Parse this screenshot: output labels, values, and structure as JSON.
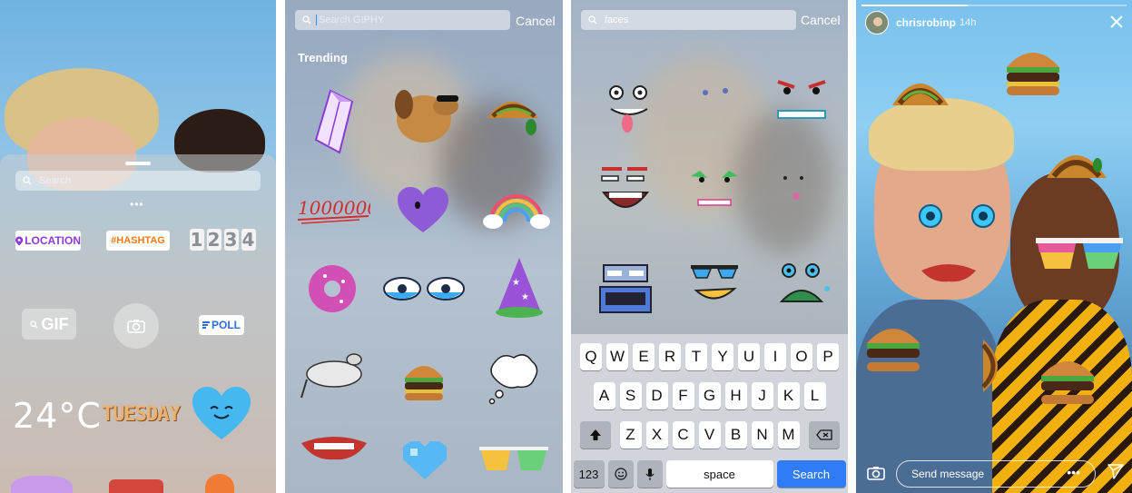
{
  "panel1": {
    "search_placeholder": "Search",
    "dots": "•••",
    "location_label": "LOCATION",
    "hashtag_label": "#HASHTAG",
    "countdown_digits": [
      "1",
      "2",
      "3",
      "4"
    ],
    "gif_label": "GIF",
    "poll_label": "POLL",
    "temperature": "24°C",
    "day": "TUESDAY"
  },
  "panel2": {
    "search_placeholder": "Search GIPHY",
    "cancel_label": "Cancel",
    "section_title": "Trending",
    "number_sticker": "1000000"
  },
  "panel3": {
    "search_value": "faces",
    "cancel_label": "Cancel",
    "keyboard": {
      "row1": [
        "Q",
        "W",
        "E",
        "R",
        "T",
        "Y",
        "U",
        "I",
        "O",
        "P"
      ],
      "row2": [
        "A",
        "S",
        "D",
        "F",
        "G",
        "H",
        "J",
        "K",
        "L"
      ],
      "row3": [
        "Z",
        "X",
        "C",
        "V",
        "B",
        "N",
        "M"
      ],
      "num_label": "123",
      "space_label": "space",
      "search_label": "Search"
    }
  },
  "panel4": {
    "username": "chrisrobinp",
    "time": "14h",
    "message_placeholder": "Send message",
    "more_label": "•••",
    "progress": 0.4
  },
  "icons": [
    "search-icon",
    "location-pin-icon",
    "camera-icon",
    "close-icon",
    "send-icon",
    "shift-icon",
    "backspace-icon",
    "emoji-icon",
    "mic-icon"
  ],
  "colors": {
    "location_purple": "#8d3ad7",
    "hashtag_orange": "#f27a1a",
    "poll_blue": "#2f6de3",
    "search_key_blue": "#2f7cf6",
    "heart_blue": "#46b8f0",
    "heart_purple": "#8d5bd6"
  }
}
